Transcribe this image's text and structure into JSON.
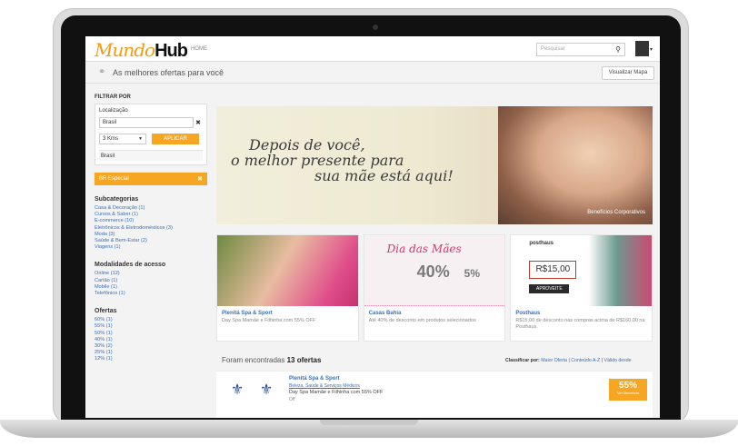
{
  "header": {
    "logo_part1": "Mundo",
    "logo_part2": "Hub",
    "home_link": "HOME",
    "search_placeholder": "Pesquisar"
  },
  "headbar": {
    "title": "As melhores ofertas para você",
    "map_button": "Visualizar Mapa"
  },
  "filters": {
    "title": "FILTRAR POR",
    "location_title": "Localização",
    "location_value": "Brasil",
    "radius_value": "3 Kms",
    "apply_label": "APLICAR",
    "location_result": "Brasil",
    "active_badge": "BR Especial",
    "subcategories_title": "Subcategorias",
    "subcategories": [
      "Casa & Decoração (1)",
      "Cursos & Saber (1)",
      "E-commerce (10)",
      "Eletrônicos & Eletrodomésticos (3)",
      "Moda (3)",
      "Saúde & Bem-Estar (2)",
      "Viagens (1)"
    ],
    "access_title": "Modalidades de acesso",
    "access": [
      "Online (12)",
      "Cartão (1)",
      "Mobile (1)",
      "Telefônico (1)"
    ],
    "offers_title": "Ofertas",
    "offers": [
      "60% (1)",
      "55% (1)",
      "50% (1)",
      "40% (1)",
      "30% (2)",
      "25% (1)",
      "12% (1)"
    ]
  },
  "banner": {
    "line1": "Depois de você,",
    "line2": "o melhor presente para",
    "line3": "sua mãe está aqui!",
    "brand": "Benefícios Corporativos"
  },
  "cards": [
    {
      "title": "Plenitá Spa & Sport",
      "desc": "Day Spa Mamãe e Filhinha com 55% OFF"
    },
    {
      "title": "Casas Bahia",
      "desc": "Até 40% de desconto em produtos selecionados",
      "promo_title": "Dia das Mães",
      "promo_a": "40%",
      "promo_b": "5%"
    },
    {
      "title": "Posthaus",
      "desc": "R$15,00 de desconto nas compras acima de R$160,00 na Posthaus.",
      "brand": "posthaus",
      "price": "R$15,00",
      "button": "APROVEITE"
    }
  ],
  "results": {
    "found_prefix": "Foram encontradas",
    "found_count": "13 ofertas",
    "sort_label": "Classificar por:",
    "sort_options": [
      "Maior Oferta",
      "Conteúdo A-Z",
      "Válido desde"
    ],
    "items": [
      {
        "title": "Plenitá Spa & Sport",
        "category": "Beleza, Saúde & Serviços Médicos",
        "desc": "Day Spa Mamãe e Filhinha com 55% OFF",
        "meta": "Off",
        "discount": "55%",
        "discount_sub": "Ver Benefício"
      }
    ]
  }
}
